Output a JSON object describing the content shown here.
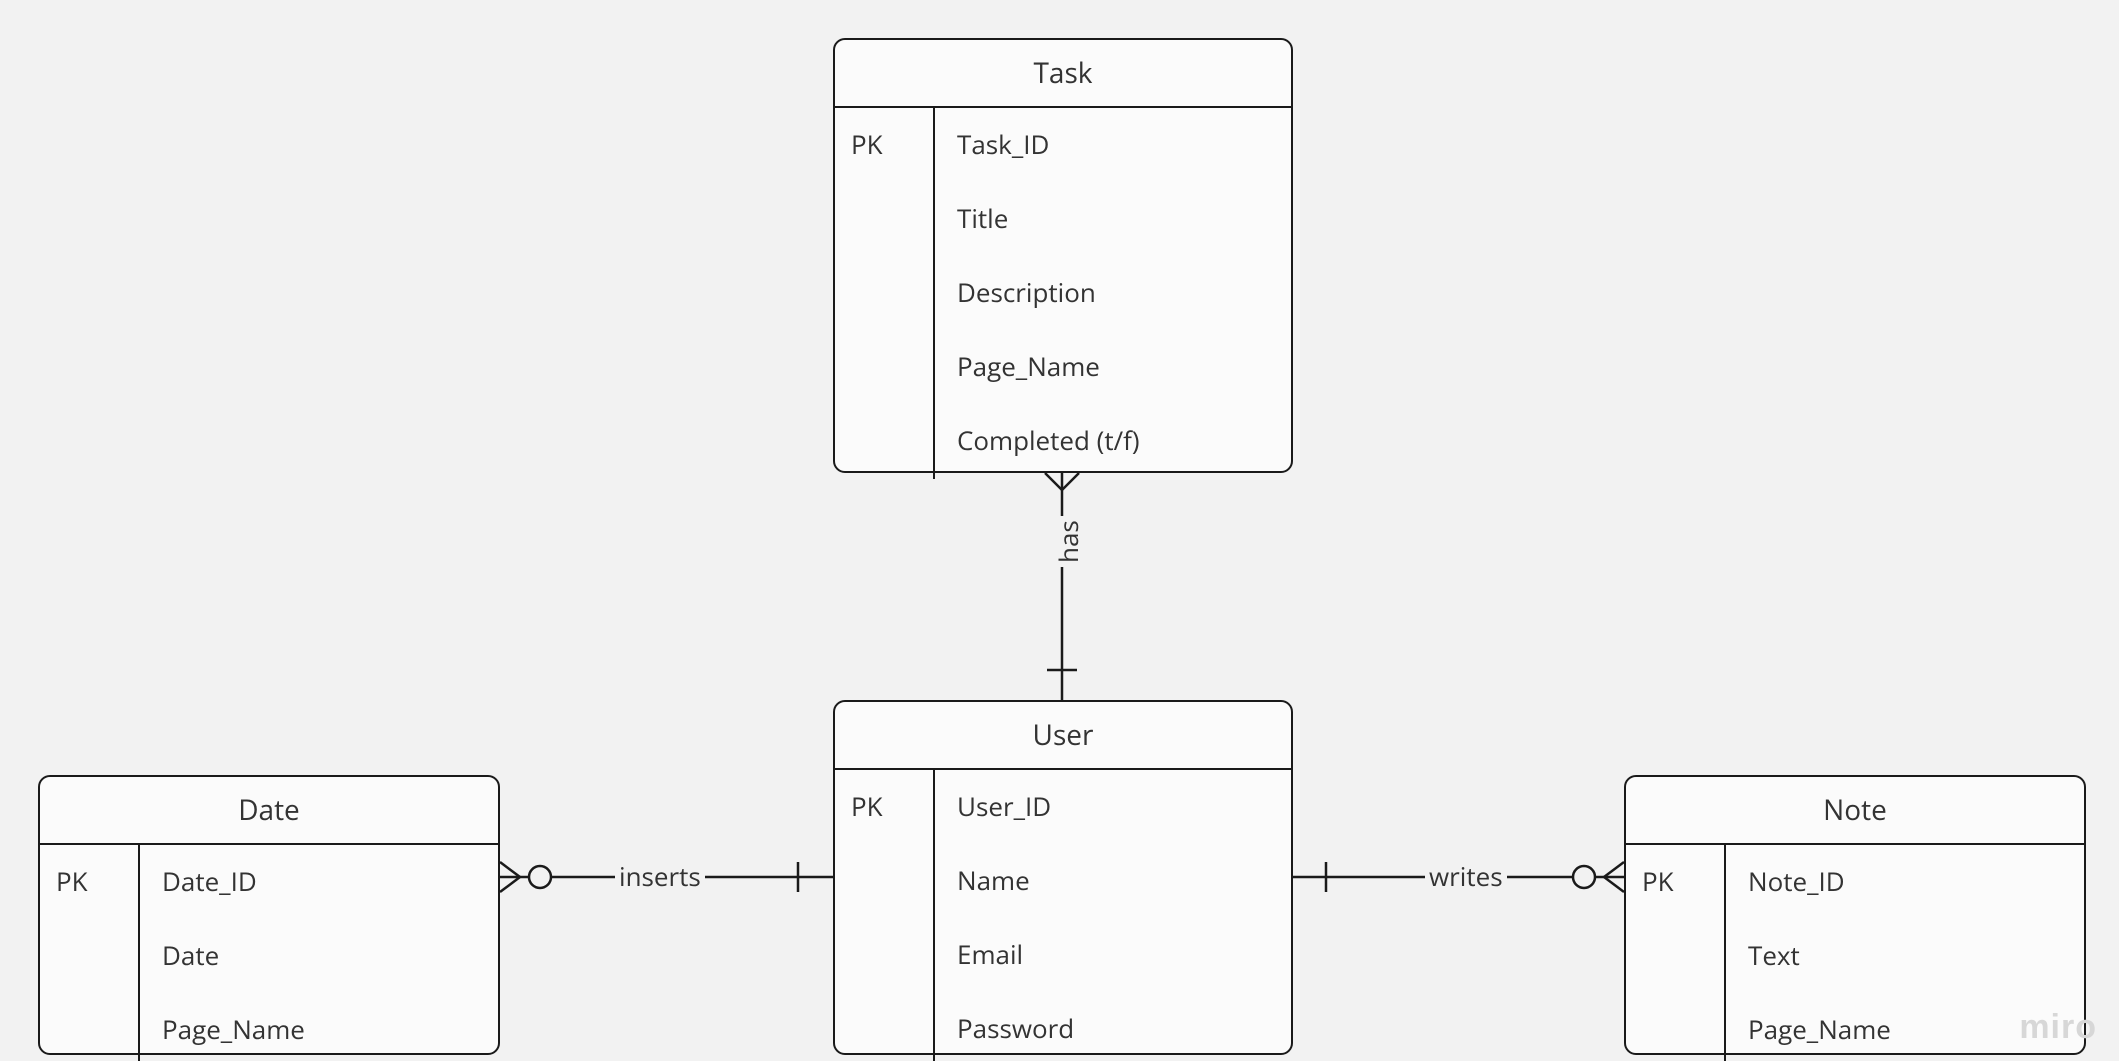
{
  "entities": {
    "task": {
      "title": "Task",
      "pk_label": "PK",
      "attrs": [
        "Task_ID",
        "Title",
        "Description",
        "Page_Name",
        "Completed (t/f)"
      ]
    },
    "user": {
      "title": "User",
      "pk_label": "PK",
      "attrs": [
        "User_ID",
        "Name",
        "Email",
        "Password"
      ]
    },
    "date": {
      "title": "Date",
      "pk_label": "PK",
      "attrs": [
        "Date_ID",
        "Date",
        "Page_Name"
      ]
    },
    "note": {
      "title": "Note",
      "pk_label": "PK",
      "attrs": [
        "Note_ID",
        "Text",
        "Page_Name"
      ]
    }
  },
  "relationships": {
    "has": "has",
    "inserts": "inserts",
    "writes": "writes"
  },
  "watermark": "miro"
}
